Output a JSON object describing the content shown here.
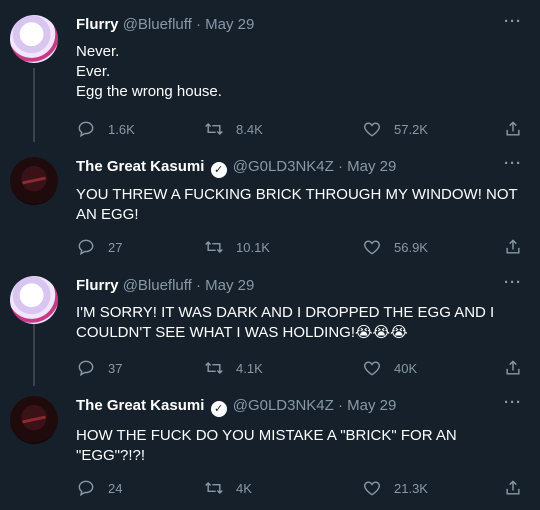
{
  "tweets": [
    {
      "name": "Flurry",
      "handle": "@Bluefluff",
      "date": "· May 29",
      "verified": false,
      "text": "Never.\nEver.\nEgg the wrong house.",
      "replies": "1.6K",
      "retweets": "8.4K",
      "likes": "57.2K"
    },
    {
      "name": "The Great Kasumi",
      "handle": "@G0LD3NK4Z",
      "date": "· May 29",
      "verified": true,
      "text": "YOU THREW A FUCKING BRICK THROUGH MY WINDOW! NOT AN EGG!",
      "replies": "27",
      "retweets": "10.1K",
      "likes": "56.9K"
    },
    {
      "name": "Flurry",
      "handle": "@Bluefluff",
      "date": "· May 29",
      "verified": false,
      "text": "I'M SORRY! IT WAS DARK AND I DROPPED THE EGG AND I COULDN'T SEE WHAT I WAS HOLDING!😭😭😭",
      "replies": "37",
      "retweets": "4.1K",
      "likes": "40K"
    },
    {
      "name": "The Great Kasumi",
      "handle": "@G0LD3NK4Z",
      "date": "· May 29",
      "verified": true,
      "text": "HOW THE FUCK DO YOU MISTAKE A \"BRICK\" FOR AN \"EGG\"?!?!",
      "replies": "24",
      "retweets": "4K",
      "likes": "21.3K"
    }
  ],
  "icons": {
    "more": "···",
    "verified": "✓",
    "reply": "reply-icon",
    "retweet": "retweet-icon",
    "like": "like-icon",
    "share": "share-icon"
  },
  "colors": {
    "background": "#15202b",
    "muted": "#8899a6",
    "thread_line": "#38444d"
  }
}
